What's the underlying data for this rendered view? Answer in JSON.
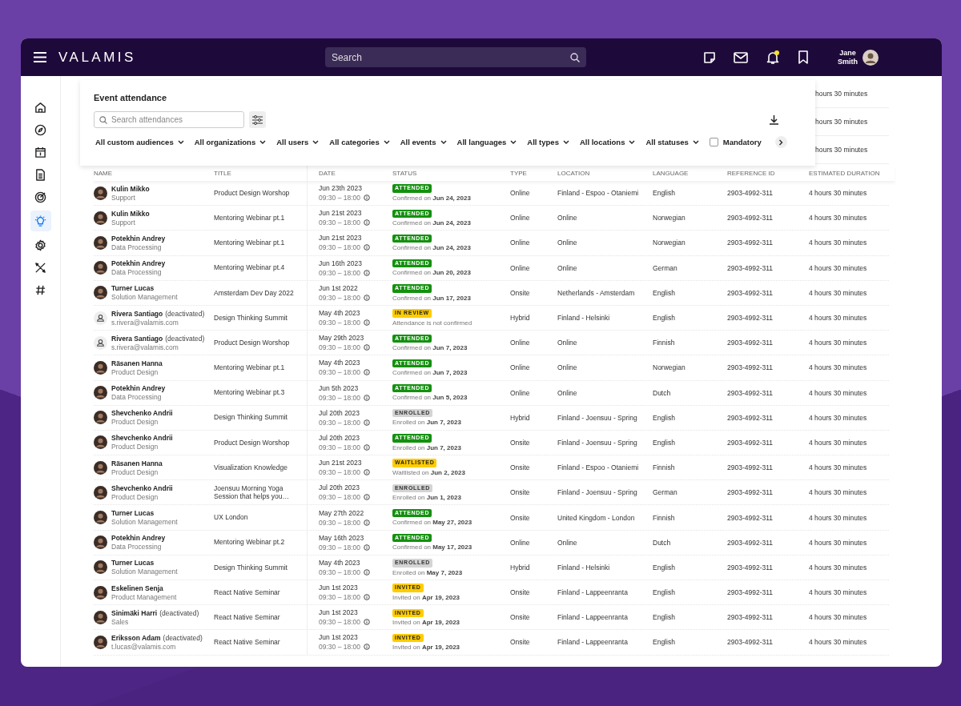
{
  "top_bar": {
    "logo": "VALAMIS",
    "search": {
      "placeholder": "Search"
    },
    "notifications_unread": true,
    "user": {
      "name": "Jane Smith"
    }
  },
  "sidebar": {
    "items": [
      {
        "kind": "home",
        "selected": false
      },
      {
        "kind": "compass",
        "selected": false
      },
      {
        "kind": "calendar",
        "selected": false
      },
      {
        "kind": "document",
        "selected": false
      },
      {
        "kind": "target",
        "selected": false
      },
      {
        "kind": "bulb",
        "selected": true
      },
      {
        "kind": "gear",
        "selected": false
      },
      {
        "kind": "tools",
        "selected": false
      },
      {
        "kind": "hash",
        "selected": false
      }
    ]
  },
  "panel": {
    "title": "Event attendance",
    "search": {
      "placeholder": "Search attendances"
    },
    "filters": [
      "All custom audiences",
      "All organizations",
      "All users",
      "All categories",
      "All events",
      "All languages",
      "All types",
      "All locations",
      "All statuses"
    ],
    "mandatory": {
      "label": "Mandatory",
      "checked": false
    }
  },
  "behind_panel": [
    "hours 30 minutes",
    "hours 30 minutes",
    "hours 30 minutes"
  ],
  "table": {
    "columns": [
      "NAME",
      "TITLE",
      "DATE",
      "STATUS",
      "TYPE",
      "LOCATION",
      "LANGUAGE",
      "REFERENCE ID",
      "ESTIMATED DURATION"
    ],
    "rows": [
      {
        "name": "Kulin Mikko",
        "sub": "Support",
        "avatar": {
          "kind": "photo"
        },
        "title": "Product Design Worshop",
        "date": "Jun 23th 2023",
        "time": "09:30 – 18:00",
        "status": {
          "label": "ATTENDED",
          "kind": "success"
        },
        "note": "Confirmed on **Jun 24, 2023**",
        "type": "Online",
        "location": "Finland - Espoo - Otaniemi",
        "language": "English",
        "ref": "2903-4992-311",
        "duration": "4 hours 30 minutes"
      },
      {
        "name": "Kulin Mikko",
        "sub": "Support",
        "avatar": {
          "kind": "photo"
        },
        "title": "Mentoring Webinar pt.1",
        "date": "Jun 21st 2023",
        "time": "09:30 – 18:00",
        "status": {
          "label": "ATTENDED",
          "kind": "success"
        },
        "note": "Confirmed on **Jun 24, 2023**",
        "type": "Online",
        "location": "Online",
        "language": "Norwegian",
        "ref": "2903-4992-311",
        "duration": "4 hours 30 minutes"
      },
      {
        "name": "Potekhin Andrey",
        "sub": "Data Processing",
        "avatar": {
          "kind": "photo"
        },
        "title": "Mentoring Webinar pt.1",
        "date": "Jun 21st 2023",
        "time": "09:30 – 18:00",
        "status": {
          "label": "ATTENDED",
          "kind": "success"
        },
        "note": "Confirmed on **Jun 24, 2023**",
        "type": "Online",
        "location": "Online",
        "language": "Norwegian",
        "ref": "2903-4992-311",
        "duration": "4 hours 30 minutes"
      },
      {
        "name": "Potekhin Andrey",
        "sub": "Data Processing",
        "avatar": {
          "kind": "photo"
        },
        "title": "Mentoring Webinar pt.4",
        "date": "Jun 16th 2023",
        "time": "09:30 – 18:00",
        "status": {
          "label": "ATTENDED",
          "kind": "success"
        },
        "note": "Confirmed on **Jun 20, 2023**",
        "type": "Online",
        "location": "Online",
        "language": "German",
        "ref": "2903-4992-311",
        "duration": "4 hours 30 minutes"
      },
      {
        "name": "Turner Lucas",
        "sub": "Solution Management",
        "avatar": {
          "kind": "photo"
        },
        "title": "Amsterdam Dev Day 2022",
        "date": "Jun 1st 2022",
        "time": "09:30 – 18:00",
        "status": {
          "label": "ATTENDED",
          "kind": "success"
        },
        "note": "Confirmed on **Jun 17, 2023**",
        "type": "Onsite",
        "location": "Netherlands - Amsterdam",
        "language": "English",
        "ref": "2903-4992-311",
        "duration": "4 hours 30 minutes"
      },
      {
        "name": "Rivera Santiago",
        "tag": "(deactivated)",
        "sub": "s.rivera@valamis.com",
        "avatar": {
          "kind": "placeholder"
        },
        "title": "Design Thinking Summit",
        "date": "May 4th 2023",
        "time": "09:30 – 18:00",
        "status": {
          "label": "IN REVIEW",
          "kind": "warning"
        },
        "note": "Attendance is not confirmed",
        "type": "Hybrid",
        "location": "Finland - Helsinki",
        "language": "English",
        "ref": "2903-4992-311",
        "duration": "4 hours 30 minutes"
      },
      {
        "name": "Rivera Santiago",
        "tag": "(deactivated)",
        "sub": "s.rivera@valamis.com",
        "avatar": {
          "kind": "placeholder"
        },
        "title": "Product Design Worshop",
        "date": "May 29th 2023",
        "time": "09:30 – 18:00",
        "status": {
          "label": "ATTENDED",
          "kind": "success"
        },
        "note": "Confirmed on **Jun 7, 2023**",
        "type": "Online",
        "location": "Online",
        "language": "Finnish",
        "ref": "2903-4992-311",
        "duration": "4 hours 30 minutes"
      },
      {
        "name": "Räsanen Hanna",
        "sub": "Product Design",
        "avatar": {
          "kind": "photo"
        },
        "title": "Mentoring Webinar pt.1",
        "date": "May 4th 2023",
        "time": "09:30 – 18:00",
        "status": {
          "label": "ATTENDED",
          "kind": "success"
        },
        "note": "Confirmed on **Jun 7, 2023**",
        "type": "Online",
        "location": "Online",
        "language": "Norwegian",
        "ref": "2903-4992-311",
        "duration": "4 hours 30 minutes"
      },
      {
        "name": "Potekhin Andrey",
        "sub": "Data Processing",
        "avatar": {
          "kind": "photo"
        },
        "title": "Mentoring Webinar pt.3",
        "date": "Jun 5th 2023",
        "time": "09:30 – 18:00",
        "status": {
          "label": "ATTENDED",
          "kind": "success"
        },
        "note": "Confirmed on **Jun 5, 2023**",
        "type": "Online",
        "location": "Online",
        "language": "Dutch",
        "ref": "2903-4992-311",
        "duration": "4 hours 30 minutes"
      },
      {
        "name": "Shevchenko Andrii",
        "sub": "Product Design",
        "avatar": {
          "kind": "photo"
        },
        "title": "Design Thinking Summit",
        "date": "Jul 20th 2023",
        "time": "09:30 – 18:00",
        "status": {
          "label": "ENROLLED",
          "kind": "neutral"
        },
        "note": "Enrolled on **Jun 7, 2023**",
        "type": "Hybrid",
        "location": "Finland - Joensuu - Spring",
        "language": "English",
        "ref": "2903-4992-311",
        "duration": "4 hours 30 minutes"
      },
      {
        "name": "Shevchenko Andrii",
        "sub": "Product Design",
        "avatar": {
          "kind": "photo"
        },
        "title": "Product Design Worshop",
        "date": "Jul 20th 2023",
        "time": "09:30 – 18:00",
        "status": {
          "label": "ATTENDED",
          "kind": "success"
        },
        "note": "Enrolled on **Jun 7, 2023**",
        "type": "Onsite",
        "location": "Finland - Joensuu - Spring",
        "language": "English",
        "ref": "2903-4992-311",
        "duration": "4 hours 30 minutes"
      },
      {
        "name": "Räsanen Hanna",
        "sub": "Product Design",
        "avatar": {
          "kind": "photo"
        },
        "title": "Visualization Knowledge",
        "date": "Jun 21st 2023",
        "time": "09:30 – 18:00",
        "status": {
          "label": "WAITLISTED",
          "kind": "warning"
        },
        "note": "Waitlisted on **Jun 2, 2023**",
        "type": "Onsite",
        "location": "Finland - Espoo - Otaniemi",
        "language": "Finnish",
        "ref": "2903-4992-311",
        "duration": "4 hours 30 minutes"
      },
      {
        "name": "Shevchenko Andrii",
        "sub": "Product Design",
        "avatar": {
          "kind": "photo"
        },
        "title": "Joensuu Morning Yoga Session that helps you…",
        "date": "Jul 20th 2023",
        "time": "09:30 – 18:00",
        "status": {
          "label": "ENROLLED",
          "kind": "neutral"
        },
        "note": "Enrolled on **Jun 1, 2023**",
        "type": "Onsite",
        "location": "Finland - Joensuu - Spring",
        "language": "German",
        "ref": "2903-4992-311",
        "duration": "4 hours 30 minutes"
      },
      {
        "name": "Turner Lucas",
        "sub": "Solution Management",
        "avatar": {
          "kind": "photo"
        },
        "title": "UX London",
        "date": "May 27th 2022",
        "time": "09:30 – 18:00",
        "status": {
          "label": "ATTENDED",
          "kind": "success"
        },
        "note": "Confirmed on **May 27, 2023**",
        "type": "Onsite",
        "location": "United Kingdom - London",
        "language": "Finnish",
        "ref": "2903-4992-311",
        "duration": "4 hours 30 minutes"
      },
      {
        "name": "Potekhin Andrey",
        "sub": "Data Processing",
        "avatar": {
          "kind": "photo"
        },
        "title": "Mentoring Webinar pt.2",
        "date": "May 16th 2023",
        "time": "09:30 – 18:00",
        "status": {
          "label": "ATTENDED",
          "kind": "success"
        },
        "note": "Confirmed on **May 17, 2023**",
        "type": "Online",
        "location": "Online",
        "language": "Dutch",
        "ref": "2903-4992-311",
        "duration": "4 hours 30 minutes"
      },
      {
        "name": "Turner Lucas",
        "sub": "Solution Management",
        "avatar": {
          "kind": "photo"
        },
        "title": "Design Thinking Summit",
        "date": "May 4th 2023",
        "time": "09:30 – 18:00",
        "status": {
          "label": "ENROLLED",
          "kind": "neutral"
        },
        "note": "Enrolled on **May 7, 2023**",
        "type": "Hybrid",
        "location": "Finland - Helsinki",
        "language": "English",
        "ref": "2903-4992-311",
        "duration": "4 hours 30 minutes"
      },
      {
        "name": "Eskelinen Senja",
        "sub": "Product Management",
        "avatar": {
          "kind": "photo"
        },
        "title": "React Native Seminar",
        "date": "Jun 1st 2023",
        "time": "09:30 – 18:00",
        "status": {
          "label": "INVITED",
          "kind": "warning"
        },
        "note": "Invited on **Apr 19, 2023**",
        "type": "Onsite",
        "location": "Finland - Lappeenranta",
        "language": "English",
        "ref": "2903-4992-311",
        "duration": "4 hours 30 minutes"
      },
      {
        "name": "Sinimäki Harri",
        "tag": "(deactivated)",
        "sub": "Sales",
        "avatar": {
          "kind": "photo"
        },
        "title": "React Native Seminar",
        "date": "Jun 1st 2023",
        "time": "09:30 – 18:00",
        "status": {
          "label": "INVITED",
          "kind": "warning"
        },
        "note": "Invited on **Apr 19, 2023**",
        "type": "Onsite",
        "location": "Finland - Lappeenranta",
        "language": "English",
        "ref": "2903-4992-311",
        "duration": "4 hours 30 minutes"
      },
      {
        "name": "Eriksson Adam",
        "tag": "(deactivated)",
        "sub": "t.lucas@valamis.com",
        "avatar": {
          "kind": "photo"
        },
        "title": "React Native Seminar",
        "date": "Jun 1st 2023",
        "time": "09:30 – 18:00",
        "status": {
          "label": "INVITED",
          "kind": "warning"
        },
        "note": "Invited on **Apr 19, 2023**",
        "type": "Onsite",
        "location": "Finland - Lappeenranta",
        "language": "English",
        "ref": "2903-4992-311",
        "duration": "4 hours 30 minutes"
      }
    ]
  }
}
